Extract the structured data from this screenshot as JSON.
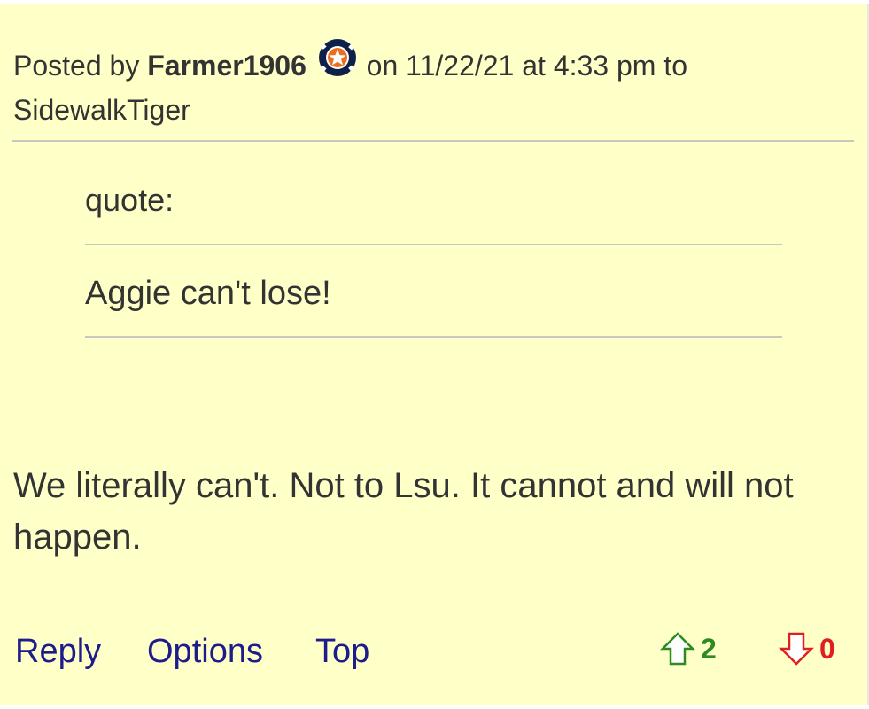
{
  "post": {
    "posted_by_label": "Posted by",
    "username": "Farmer1906",
    "team_icon": "astros-logo-icon",
    "date_text": "on 11/22/21 at 4:33 pm to",
    "reply_to": "SidewalkTiger"
  },
  "quote": {
    "label": "quote:",
    "text": "Aggie can't lose!"
  },
  "body": {
    "text": "We literally can't. Not to Lsu. It cannot and will not happen."
  },
  "actions": {
    "reply_label": "Reply",
    "options_label": "Options",
    "top_label": "Top"
  },
  "votes": {
    "up_icon": "arrow-up-outline-icon",
    "up_count": "2",
    "up_color": "#2e8b22",
    "down_icon": "arrow-down-outline-icon",
    "down_count": "0",
    "down_color": "#e02020"
  },
  "colors": {
    "background": "#ffffc8",
    "text": "#333333",
    "link": "#1c1c8a"
  }
}
